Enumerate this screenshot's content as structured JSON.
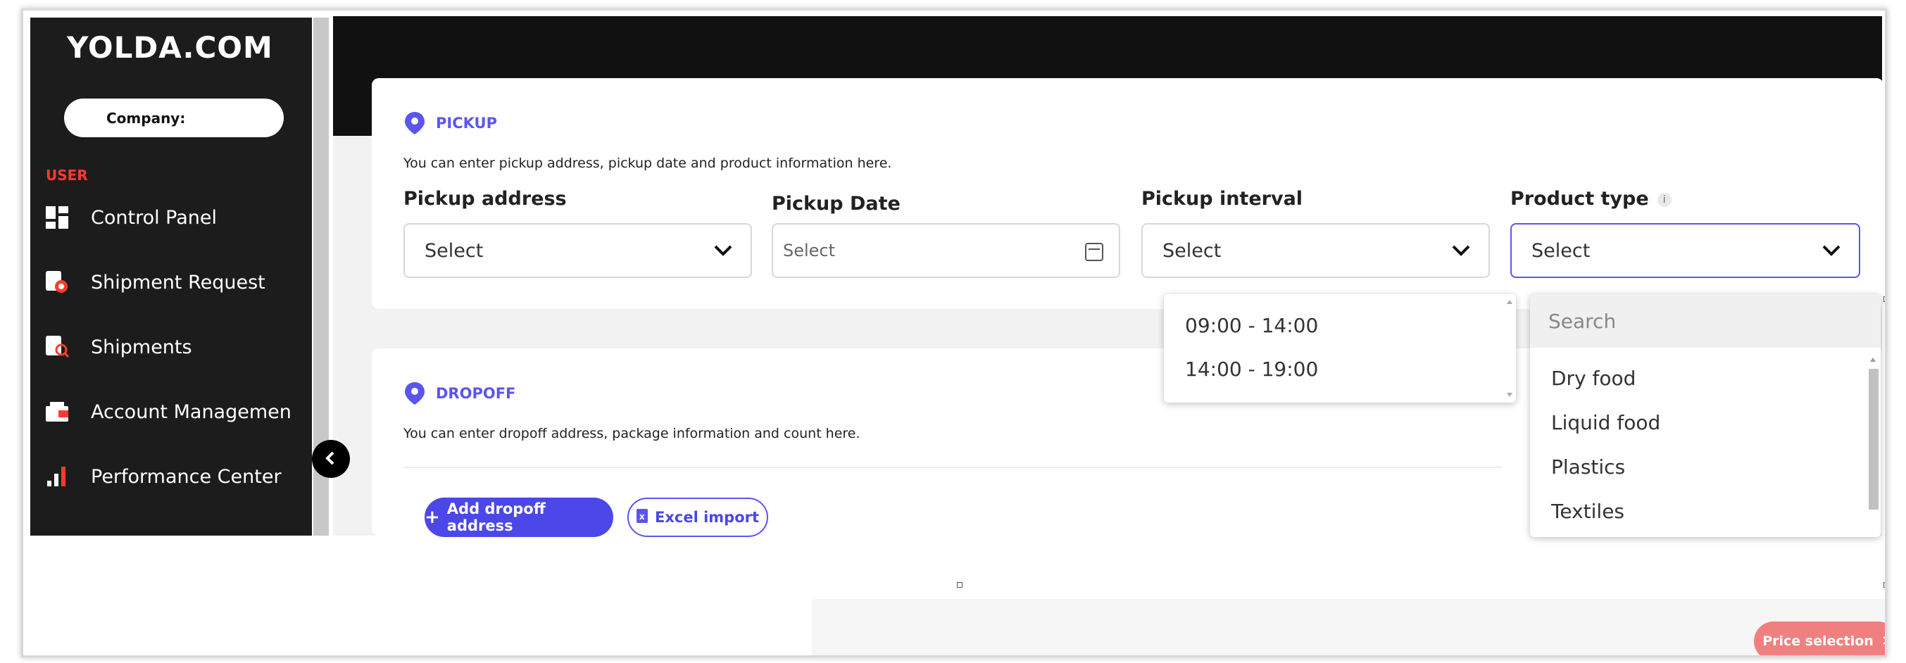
{
  "app": {
    "logo": "YOLDA.COM"
  },
  "sidebar": {
    "company_label": "Company:",
    "section": "USER",
    "items": [
      {
        "label": "Control Panel",
        "icon": "dashboard-icon"
      },
      {
        "label": "Shipment Request",
        "icon": "shipment-request-icon"
      },
      {
        "label": "Shipments",
        "icon": "shipments-search-icon"
      },
      {
        "label": "Account Managemen",
        "icon": "wallet-icon"
      },
      {
        "label": "Performance Center",
        "icon": "bar-chart-icon"
      }
    ]
  },
  "pickup": {
    "title": "PICKUP",
    "description": "You can enter pickup address, pickup date and product information here.",
    "address": {
      "label": "Pickup address",
      "value": "Select"
    },
    "date": {
      "label": "Pickup Date",
      "placeholder": "Select"
    },
    "interval": {
      "label": "Pickup interval",
      "value": "Select",
      "options": [
        "09:00 - 14:00",
        "14:00 - 19:00"
      ]
    },
    "product_type": {
      "label": "Product type",
      "value": "Select",
      "search_placeholder": "Search",
      "options": [
        "Dry food",
        "Liquid food",
        "Plastics",
        "Textiles"
      ]
    }
  },
  "dropoff": {
    "title": "DROPOFF",
    "description": "You can enter dropoff address, package information and count here.",
    "add_button": "Add dropoff address",
    "import_button": "Excel import"
  },
  "footer": {
    "price_button": "Price selection"
  },
  "colors": {
    "accent": "#5b55f0",
    "sidebar_bg": "#1c1c1c",
    "user_section": "#ff3b30",
    "price_button": "#f08080"
  }
}
